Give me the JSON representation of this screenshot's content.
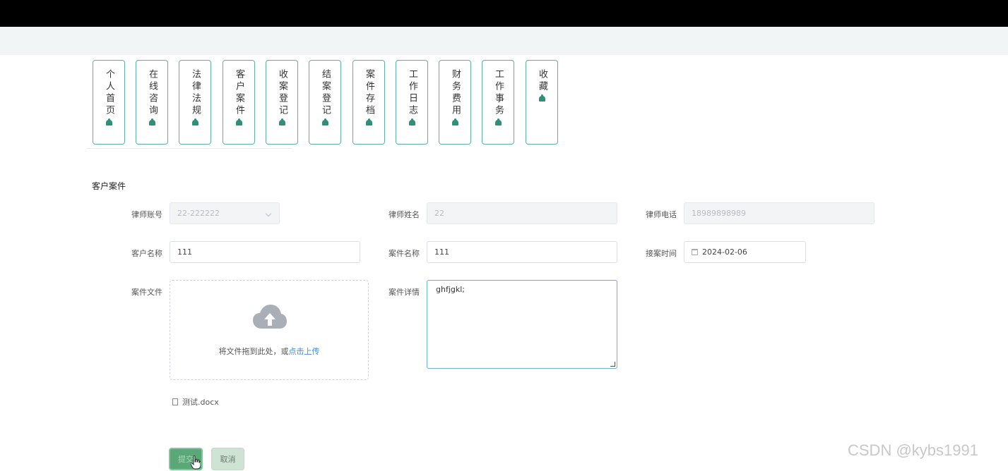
{
  "nav": {
    "items": [
      {
        "label": "个人首页",
        "icon": "pot-icon"
      },
      {
        "label": "在线咨询",
        "icon": "pot-icon"
      },
      {
        "label": "法律法规",
        "icon": "pot-icon"
      },
      {
        "label": "客户案件",
        "icon": "pot-icon"
      },
      {
        "label": "收案登记",
        "icon": "pot-icon"
      },
      {
        "label": "结案登记",
        "icon": "pot-icon"
      },
      {
        "label": "案件存档",
        "icon": "pot-icon"
      },
      {
        "label": "工作日志",
        "icon": "pot-icon"
      },
      {
        "label": "财务费用",
        "icon": "pot-icon"
      },
      {
        "label": "工作事务",
        "icon": "pot-icon"
      },
      {
        "label": "收藏",
        "icon": "pot-icon"
      }
    ],
    "accent": "#5ab0a4"
  },
  "section": {
    "title": "客户案件"
  },
  "form": {
    "lawyer_account": {
      "label": "律师账号",
      "value": "22-222222"
    },
    "lawyer_name": {
      "label": "律师姓名",
      "value": "22"
    },
    "lawyer_phone": {
      "label": "律师电话",
      "value": "18989898989"
    },
    "client_name": {
      "label": "客户名称",
      "value": "111"
    },
    "case_name": {
      "label": "案件名称",
      "value": "111"
    },
    "accept_time": {
      "label": "接案时间",
      "value": "2024-02-06"
    },
    "case_file": {
      "label": "案件文件",
      "upload_text": "将文件拖到此处，或",
      "upload_link": "点击上传",
      "file_name": "测试.docx"
    },
    "case_detail": {
      "label": "案件详情",
      "value": "ghfjgkl;"
    }
  },
  "buttons": {
    "submit": "提交",
    "cancel": "取消"
  },
  "watermark": "CSDN @kybs1991"
}
